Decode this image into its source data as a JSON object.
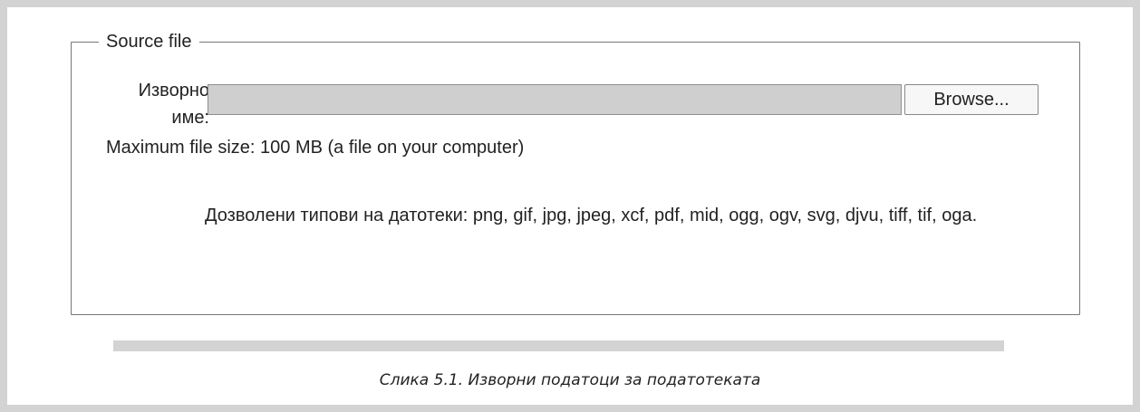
{
  "fieldset": {
    "legend": "Source file",
    "source_name_label": "Изворно\nиме:",
    "file_input_value": "",
    "browse_button_label": "Browse...",
    "max_file_size_text": "Maximum file size: 100 MB (a file on your computer)",
    "allowed_types_text": "Дозволени типови на датотеки: png, gif, jpg, jpeg, xcf, pdf, mid, ogg, ogv, svg, djvu, tiff, tif, oga."
  },
  "caption": "Слика 5.1. Изворни податоци за податотеката"
}
